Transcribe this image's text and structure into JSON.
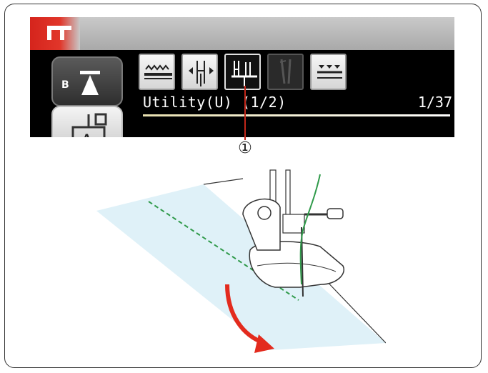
{
  "lcd": {
    "title": "Utility(U) (1/2)",
    "page_count": "1/37",
    "side_buttons": [
      {
        "letter": "B",
        "name": "foot-up-down"
      },
      {
        "letter": "A",
        "name": "presser-foot"
      }
    ],
    "tools": [
      {
        "name": "feed-dog-icon",
        "state": "normal"
      },
      {
        "name": "needle-position-icon",
        "state": "normal"
      },
      {
        "name": "lock-stitch-icon",
        "state": "selected"
      },
      {
        "name": "twin-needle-icon",
        "state": "disabled"
      },
      {
        "name": "stitch-elongation-icon",
        "state": "normal"
      }
    ],
    "colors": {
      "red_bar": "#d5241c",
      "screen_bg": "#000000",
      "selected_bg": "#111111"
    }
  },
  "callout": {
    "number": "①"
  },
  "illustration": {
    "fabric_color": "#dff1f8",
    "stitch_color": "#2f9a4a",
    "arrow_color": "#e32b1e"
  }
}
